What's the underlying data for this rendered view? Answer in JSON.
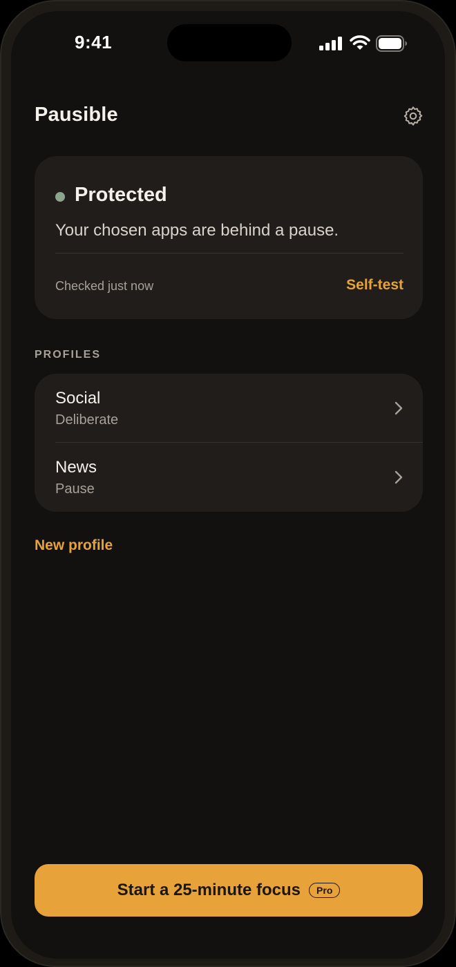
{
  "status_bar": {
    "time": "9:41",
    "icons": [
      "signal-icon",
      "wifi-icon",
      "battery-icon"
    ]
  },
  "header": {
    "title": "Pausible",
    "settings_icon": "gear-icon"
  },
  "status_card": {
    "state": "Protected",
    "description": "Your chosen apps are behind a pause.",
    "checked_text": "Checked just now",
    "self_test_label": "Self-test",
    "status_color": "#8aa58a"
  },
  "profiles": {
    "section_label": "PROFILES",
    "items": [
      {
        "name": "Social",
        "mode": "Deliberate"
      },
      {
        "name": "News",
        "mode": "Pause"
      }
    ],
    "new_profile_label": "New profile"
  },
  "focus_button": {
    "label": "Start a 25-minute focus",
    "badge": "Pro"
  },
  "colors": {
    "accent": "#e8a23a",
    "background": "#121110",
    "card": "#201d1a"
  }
}
